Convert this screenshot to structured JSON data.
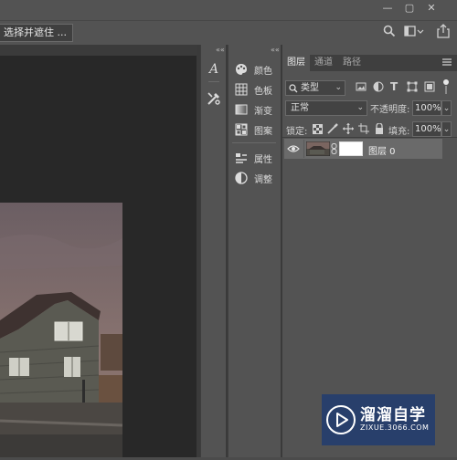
{
  "window": {
    "minimize_icon": "minimize-icon",
    "maximize_icon": "maximize-icon",
    "close_icon": "close-icon"
  },
  "options_bar": {
    "select_mask_label": "选择并遮住 ...",
    "search_icon": "search-icon",
    "share_icon": "share-icon"
  },
  "collapse_glyph": "««",
  "tool_strip": {
    "items": [
      "character-icon",
      "tools-icon"
    ]
  },
  "panels_strip": {
    "items": [
      {
        "label": "颜色",
        "icon": "color-palette-icon"
      },
      {
        "label": "色板",
        "icon": "swatches-icon"
      },
      {
        "label": "渐变",
        "icon": "gradient-icon"
      },
      {
        "label": "图案",
        "icon": "pattern-icon"
      },
      {
        "label": "属性",
        "icon": "properties-icon"
      },
      {
        "label": "调整",
        "icon": "adjustments-icon"
      }
    ]
  },
  "layers_panel": {
    "tabs": [
      "图层",
      "通道",
      "路径"
    ],
    "active_tab": 0,
    "filter_kind": "类型",
    "blend_mode": "正常",
    "opacity_label": "不透明度:",
    "opacity_value": "100%",
    "lock_label": "锁定:",
    "fill_label": "填充:",
    "fill_value": "100%",
    "layer": {
      "name": "图层 0",
      "visible": true
    }
  },
  "watermark": {
    "brand": "溜溜自学",
    "url": "ZIXUE.3066.COM"
  }
}
